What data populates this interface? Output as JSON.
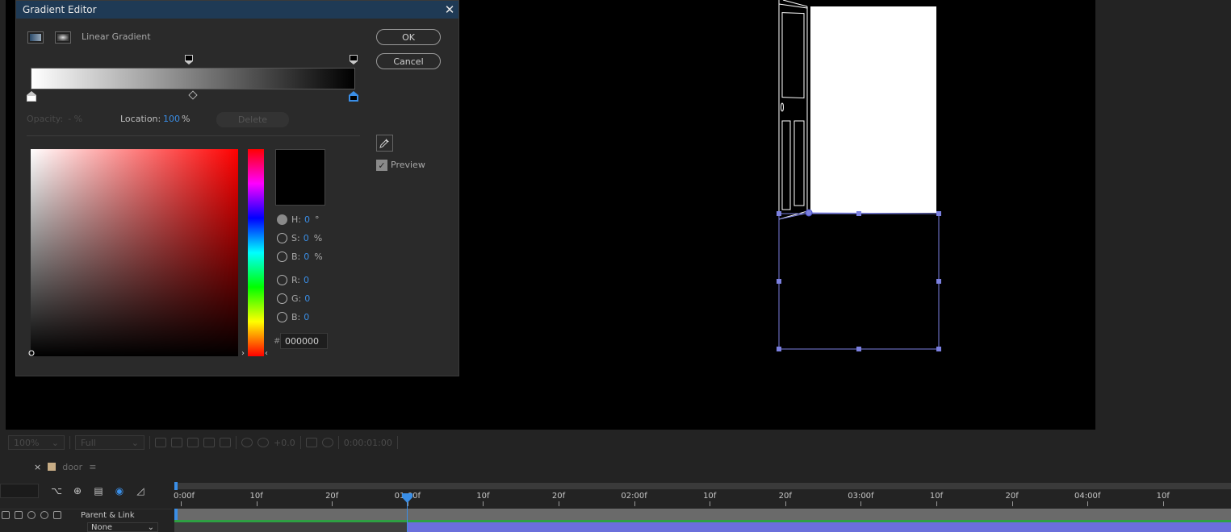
{
  "dialog": {
    "title": "Gradient Editor",
    "gradient_type_label": "Linear Gradient",
    "ok_label": "OK",
    "cancel_label": "Cancel",
    "opacity_label": "Opacity:",
    "opacity_value": "- %",
    "location_label": "Location:",
    "location_value": "100",
    "location_unit": "%",
    "delete_label": "Delete",
    "preview_label": "Preview",
    "channels": {
      "h": {
        "label": "H:",
        "value": "0",
        "unit": "°"
      },
      "s": {
        "label": "S:",
        "value": "0",
        "unit": "%"
      },
      "b": {
        "label": "B:",
        "value": "0",
        "unit": "%"
      },
      "r": {
        "label": "R:",
        "value": "0"
      },
      "g": {
        "label": "G:",
        "value": "0"
      },
      "b2": {
        "label": "B:",
        "value": "0"
      }
    },
    "hex_hash": "#",
    "hex_value": "000000",
    "gradient_colors": {
      "start": "#ffffff",
      "end": "#000000"
    },
    "current_color": "#000000"
  },
  "viewer_toolbar": {
    "zoom": "100%",
    "resolution": "Full",
    "exposure": "+0.0",
    "timecode": "0:00:01:00"
  },
  "timeline": {
    "close": "×",
    "comp_name": "door",
    "menu": "≡",
    "parent_link_label": "Parent & Link",
    "parent_value": "None",
    "ruler_labels": [
      "0:00f",
      "10f",
      "20f",
      "01:00f",
      "10f",
      "20f",
      "02:00f",
      "10f",
      "20f",
      "03:00f",
      "10f",
      "20f",
      "04:00f",
      "10f"
    ]
  },
  "colors": {
    "accent": "#3a8ee6",
    "layer_bar": "#6a6fdb",
    "title_bar": "#1f3a55",
    "work_area": "#2ea043"
  }
}
